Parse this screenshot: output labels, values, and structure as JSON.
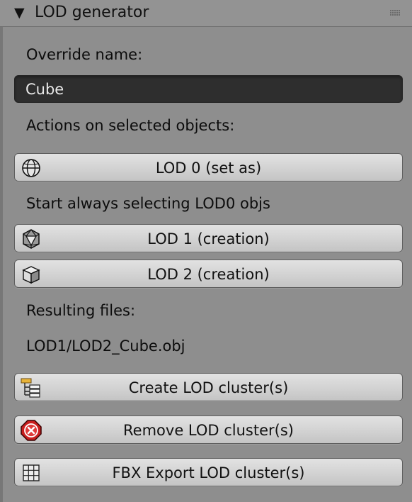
{
  "panel": {
    "title": "LOD generator",
    "collapse_glyph": "▼"
  },
  "override": {
    "label": "Override name:",
    "value": "Cube"
  },
  "actions_label": "Actions on selected objects:",
  "buttons": {
    "lod0": {
      "label": "LOD 0 (set as)",
      "icon": "sphere-icon"
    },
    "lod1": {
      "label": "LOD 1 (creation)",
      "icon": "icosphere-icon"
    },
    "lod2": {
      "label": "LOD 2 (creation)",
      "icon": "cube-icon"
    },
    "create": {
      "label": "Create LOD cluster(s)",
      "icon": "outliner-tree-icon"
    },
    "remove": {
      "label": "Remove LOD cluster(s)",
      "icon": "cancel-icon"
    },
    "export": {
      "label": "FBX Export LOD cluster(s)",
      "icon": "grid-icon"
    }
  },
  "select_hint": "Start always selecting LOD0 objs",
  "resulting_label": "Resulting files:",
  "resulting_value": "LOD1/LOD2_Cube.obj",
  "colors": {
    "panel_bg": "#8e8e8e",
    "field_bg": "#2e2e2e",
    "button_bg": "#d6d6d6",
    "remove_red": "#d42b2b"
  }
}
